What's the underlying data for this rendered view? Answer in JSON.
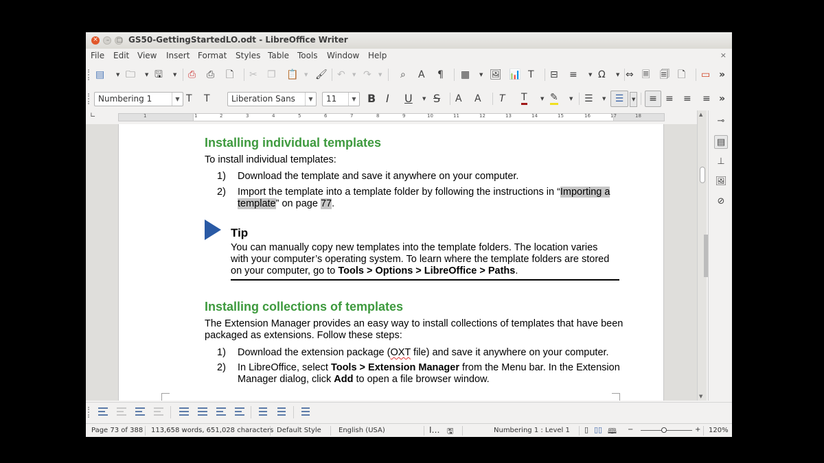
{
  "window": {
    "title": "GS50-GettingStartedLO.odt - LibreOffice Writer",
    "close_symbol": "×",
    "min_symbol": "–",
    "max_symbol": "□"
  },
  "menu": {
    "items": [
      "File",
      "Edit",
      "View",
      "Insert",
      "Format",
      "Styles",
      "Table",
      "Tools",
      "Window",
      "Help"
    ],
    "doc_close": "×"
  },
  "formatting": {
    "paragraph_style": "Numbering 1",
    "font_name": "Liberation Sans",
    "font_size": "11"
  },
  "ruler": {
    "numbers": [
      "1",
      "1",
      "2",
      "3",
      "4",
      "5",
      "6",
      "7",
      "8",
      "9",
      "10",
      "11",
      "12",
      "13",
      "14",
      "15",
      "16",
      "17",
      "18"
    ]
  },
  "document": {
    "heading1": "Installing individual templates",
    "intro1": "To install individual templates:",
    "list1": [
      {
        "num": "1)",
        "text": "Download the template and save it anywhere on your computer."
      },
      {
        "num": "2)",
        "line1_a": "Import the template into a template folder by following the instructions in “",
        "line1_link": "Importing a",
        "line2_link": "template",
        "line2_b": "” on page ",
        "line2_page": "77",
        "line2_end": "."
      }
    ],
    "tip": {
      "title": "Tip",
      "line1": "You can manually copy new templates into the template folders. The location varies",
      "line2": "with your computer’s operating system. To learn where the template folders are stored",
      "line3_a": "on your computer, go to ",
      "line3_bold": "Tools > Options > LibreOffice > Paths",
      "line3_end": "."
    },
    "heading2": "Installing collections of templates",
    "intro2_line1": "The Extension Manager provides an easy way to install collections of templates that have been",
    "intro2_line2": "packaged as extensions. Follow these steps:",
    "list2": [
      {
        "num": "1)",
        "a": "Download the extension package (",
        "squiggle": "OXT",
        "b": " file) and save it anywhere on your computer."
      },
      {
        "num": "2)",
        "a": "In LibreOffice, select ",
        "bold1": "Tools > Extension Manager",
        "b": " from the Menu bar. In the Extension",
        "line2_a": "Manager dialog, click ",
        "bold2": "Add",
        "line2_b": " to open a file browser window."
      }
    ]
  },
  "status": {
    "page": "Page 73 of 388",
    "words": "113,658 words, 651,028 characters",
    "page_style": "Default Style",
    "language": "English (USA)",
    "outline": "Numbering 1 : Level 1",
    "zoom_minus": "−",
    "zoom_plus": "+",
    "zoom": "120%"
  },
  "icons": {
    "more": "»"
  }
}
